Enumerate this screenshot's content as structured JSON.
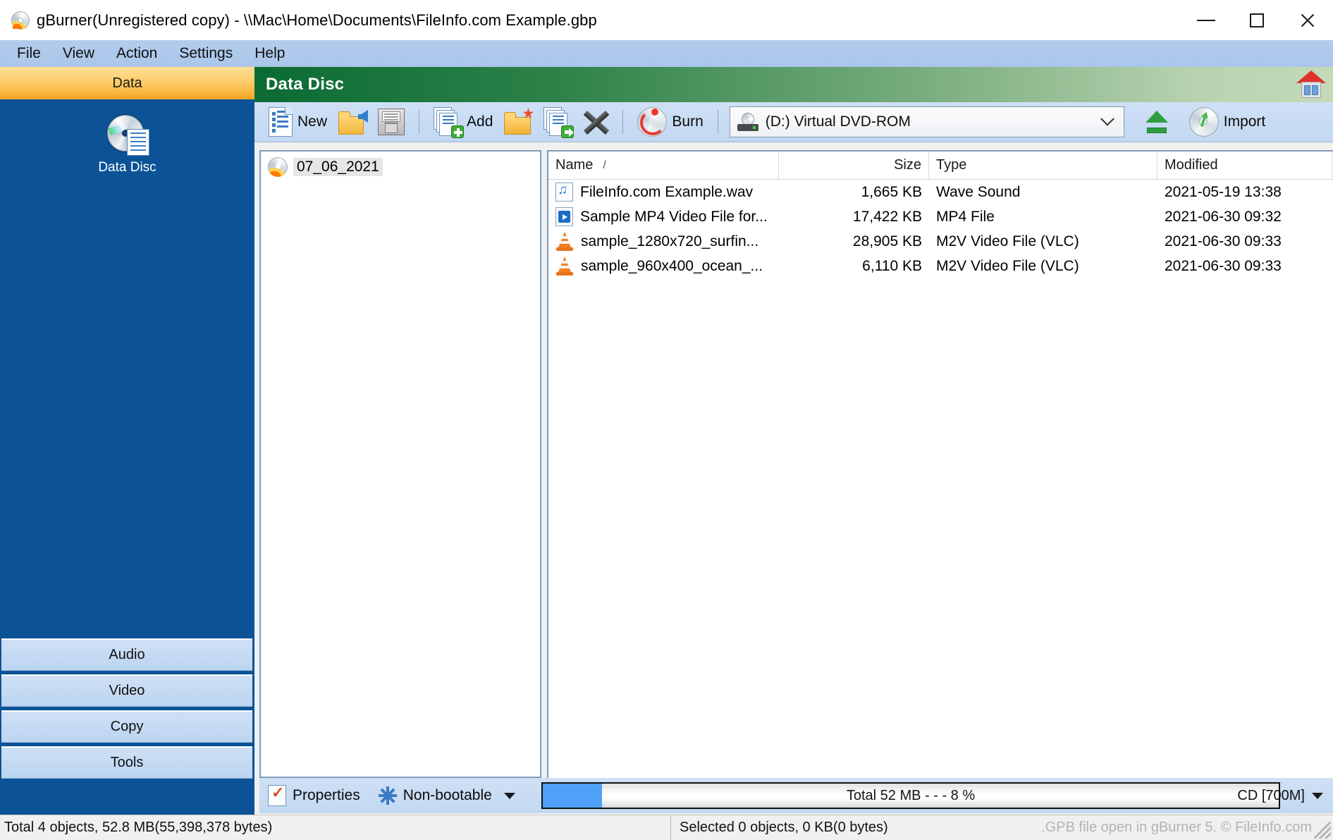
{
  "window": {
    "title": "gBurner(Unregistered copy) - \\\\Mac\\Home\\Documents\\FileInfo.com Example.gbp",
    "minimize_label": "Minimize",
    "maximize_label": "Maximize",
    "close_label": "Close"
  },
  "menubar": {
    "items": [
      "File",
      "View",
      "Action",
      "Settings",
      "Help"
    ]
  },
  "sidebar": {
    "active_tab": "Data",
    "entry": {
      "label": "Data Disc"
    },
    "tabs": [
      "Audio",
      "Video",
      "Copy",
      "Tools"
    ]
  },
  "content": {
    "header_title": "Data Disc",
    "home_tooltip": "Home"
  },
  "toolbar": {
    "new_label": "New",
    "open_label": "Open",
    "save_label": "Save",
    "add_label": "Add",
    "add_folder_label": "Add folder",
    "extract_label": "Extract",
    "delete_label": "Delete",
    "burn_label": "Burn",
    "drive_value": "(D:) Virtual DVD-ROM",
    "eject_label": "Eject",
    "import_label": "Import"
  },
  "tree": {
    "root_label": "07_06_2021"
  },
  "filelist": {
    "columns": [
      "Name",
      "Size",
      "Type",
      "Modified"
    ],
    "sort_indicator": "/",
    "rows": [
      {
        "icon": "wav-file-icon",
        "name": "FileInfo.com Example.wav",
        "size": "1,665 KB",
        "type": "Wave Sound",
        "modified": "2021-05-19 13:38"
      },
      {
        "icon": "mp4-file-icon",
        "name": "Sample MP4 Video File for...",
        "size": "17,422 KB",
        "type": "MP4 File",
        "modified": "2021-06-30 09:32"
      },
      {
        "icon": "vlc-file-icon",
        "name": "sample_1280x720_surfin...",
        "size": "28,905 KB",
        "type": "M2V Video File (VLC)",
        "modified": "2021-06-30 09:33"
      },
      {
        "icon": "vlc-file-icon",
        "name": "sample_960x400_ocean_...",
        "size": "6,110 KB",
        "type": "M2V Video File (VLC)",
        "modified": "2021-06-30 09:33"
      }
    ]
  },
  "bottombar": {
    "properties_label": "Properties",
    "bootable_label": "Non-bootable",
    "progress_text": "Total  52 MB  - - -  8 %",
    "progress_percent": 8,
    "capacity_label": "CD [700M]"
  },
  "statusbar": {
    "total": "Total 4 objects, 52.8 MB(55,398,378 bytes)",
    "selected": "Selected 0 objects, 0 KB(0 bytes)",
    "watermark": ".GPB file open in gBurner 5. © FileInfo.com"
  },
  "colors": {
    "sidebar_bg": "#0b5396",
    "accent_orange": "#f5a623",
    "header_green": "#0a6b33",
    "progress_blue": "#4ea1f7"
  }
}
